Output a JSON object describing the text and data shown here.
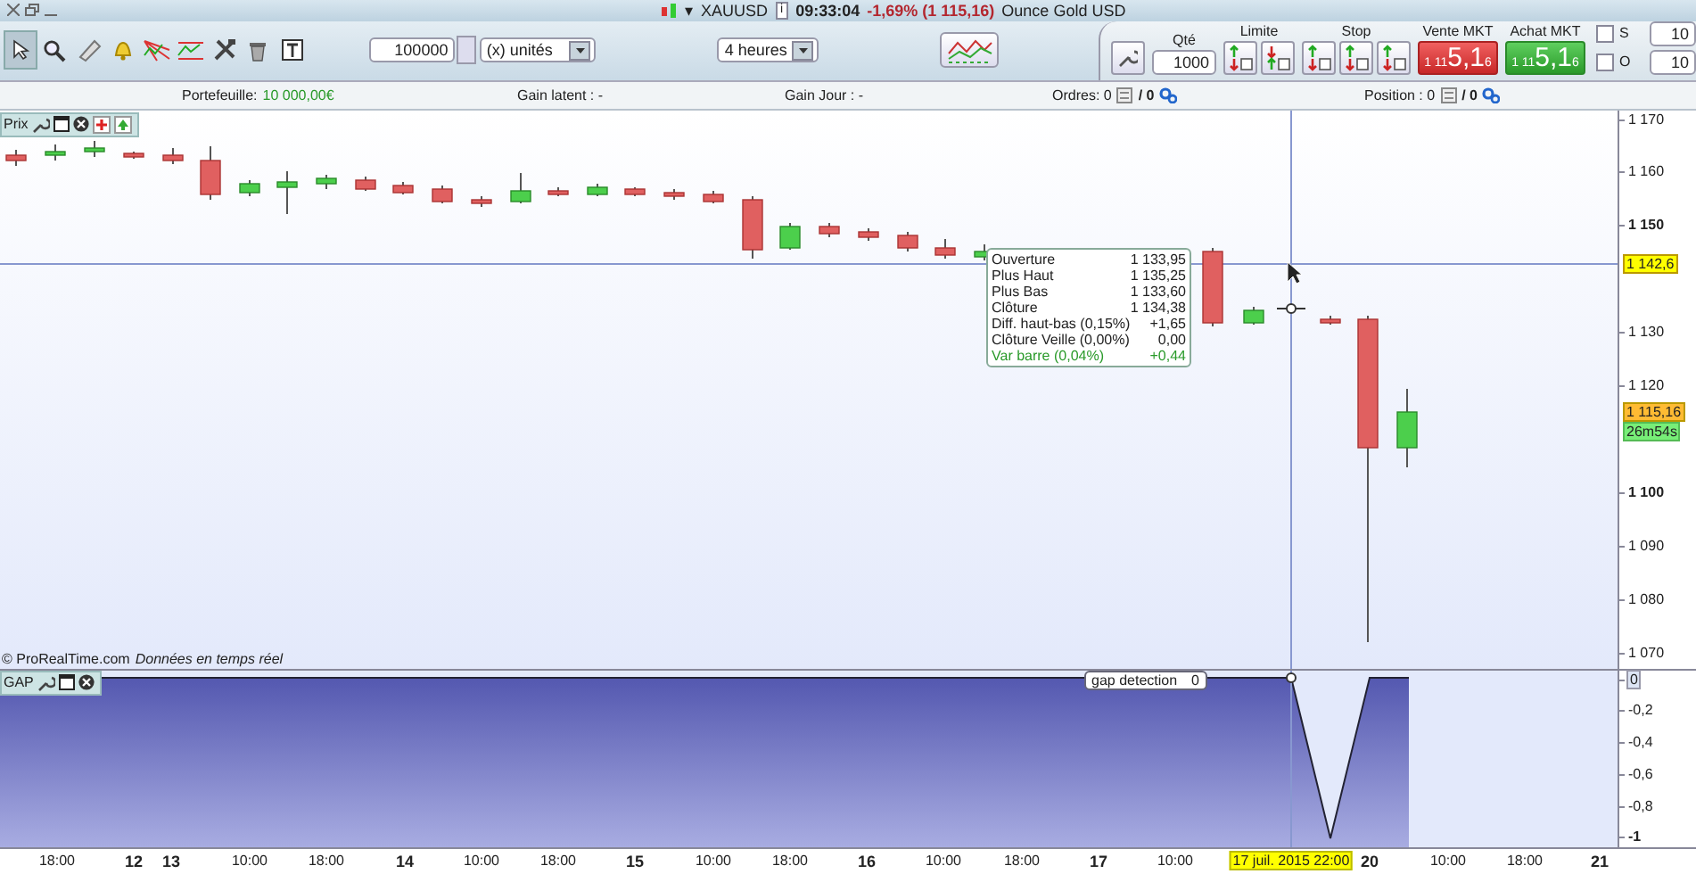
{
  "title_bar": {
    "menu_caret": "▾",
    "symbol": "XAUUSD",
    "info": "i",
    "time": "09:33:04",
    "change": "-1,69% (1 115,16)",
    "description": "Ounce Gold USD"
  },
  "toolbar": {
    "tools": [
      {
        "kind": "pointer",
        "selected": true
      },
      {
        "kind": "zoom",
        "selected": false
      },
      {
        "kind": "ruler",
        "selected": false
      },
      {
        "kind": "alert",
        "selected": false
      },
      {
        "kind": "fan",
        "selected": false
      },
      {
        "kind": "channel",
        "selected": false
      },
      {
        "kind": "tools",
        "selected": false
      },
      {
        "kind": "trash",
        "selected": false
      },
      {
        "kind": "text",
        "selected": false
      }
    ],
    "quantity": "100000",
    "unit": "(x) unités",
    "period": "4 heures"
  },
  "trading": {
    "qty_label": "Qté",
    "qty": "1000",
    "limit_label": "Limite",
    "stop_label": "Stop",
    "sell": {
      "label": "Vente MKT",
      "prefix": "1 11",
      "big": "5,1",
      "sup": "6"
    },
    "buy": {
      "label": "Achat MKT",
      "prefix": "1 11",
      "big": "5,1",
      "sup": "6"
    },
    "options": [
      {
        "label": "S",
        "checked": false,
        "value": "10"
      },
      {
        "label": "O",
        "checked": false,
        "value": "10"
      }
    ]
  },
  "info_bar": {
    "portfolio_label": "Portefeuille:",
    "portfolio_value": "10 000,00€",
    "unrealized": "Gain latent : -",
    "daily": "Gain Jour : -",
    "orders": "Ordres: 0",
    "orders_sep": "/ 0",
    "position": "Position : 0",
    "position_sep": "/ 0"
  },
  "price_panel": {
    "title": "Prix",
    "ticks": [
      {
        "label": "1 170",
        "bold": false
      },
      {
        "label": "1 160",
        "bold": false
      },
      {
        "label": "1 150",
        "bold": true
      },
      {
        "label": "1 130",
        "bold": false
      },
      {
        "label": "1 120",
        "bold": false
      },
      {
        "label": "1 100",
        "bold": true
      },
      {
        "label": "1 090",
        "bold": false
      },
      {
        "label": "1 080",
        "bold": false
      },
      {
        "label": "1 070",
        "bold": false
      }
    ],
    "crosshair_price": "1 142,6",
    "last_price": "1 115,16",
    "countdown": "26m54s",
    "tooltip": [
      {
        "label": "Ouverture",
        "value": "1 133,95",
        "positive": false
      },
      {
        "label": "Plus Haut",
        "value": "1 135,25",
        "positive": false
      },
      {
        "label": "Plus Bas",
        "value": "1 133,60",
        "positive": false
      },
      {
        "label": "Clôture",
        "value": "1 134,38",
        "positive": false
      },
      {
        "label": "Diff. haut-bas (0,15%)",
        "value": "+1,65",
        "positive": false
      },
      {
        "label": "Clôture Veille (0,00%)",
        "value": "0,00",
        "positive": false
      },
      {
        "label": "Var barre (0,04%)",
        "value": "+0,44",
        "positive": true
      }
    ],
    "credit": "© ProRealTime.com",
    "credit_note": "Données en temps réel"
  },
  "gap_panel": {
    "title": "GAP",
    "label": "gap detection",
    "value": "0",
    "ticks": [
      {
        "label": "0",
        "bold": false,
        "boxed": true
      },
      {
        "label": "-0,2",
        "bold": false,
        "boxed": false
      },
      {
        "label": "-0,4",
        "bold": false,
        "boxed": false
      },
      {
        "label": "-0,6",
        "bold": false,
        "boxed": false
      },
      {
        "label": "-0,8",
        "bold": false,
        "boxed": false
      },
      {
        "label": "-1",
        "bold": true,
        "boxed": false
      }
    ]
  },
  "time_axis": {
    "ticks": [
      {
        "label": "18:00",
        "bold": false
      },
      {
        "label": "12",
        "bold": true
      },
      {
        "label": "13",
        "bold": true
      },
      {
        "label": "10:00",
        "bold": false
      },
      {
        "label": "18:00",
        "bold": false
      },
      {
        "label": "14",
        "bold": true
      },
      {
        "label": "10:00",
        "bold": false
      },
      {
        "label": "18:00",
        "bold": false
      },
      {
        "label": "15",
        "bold": true
      },
      {
        "label": "10:00",
        "bold": false
      },
      {
        "label": "18:00",
        "bold": false
      },
      {
        "label": "16",
        "bold": true
      },
      {
        "label": "10:00",
        "bold": false
      },
      {
        "label": "18:00",
        "bold": false
      },
      {
        "label": "17",
        "bold": true
      },
      {
        "label": "10:00",
        "bold": false
      },
      {
        "label": "20",
        "bold": true
      },
      {
        "label": "10:00",
        "bold": false
      },
      {
        "label": "18:00",
        "bold": false
      },
      {
        "label": "21",
        "bold": true
      }
    ],
    "cursor_label": "17 juil. 2015 22:00"
  }
}
